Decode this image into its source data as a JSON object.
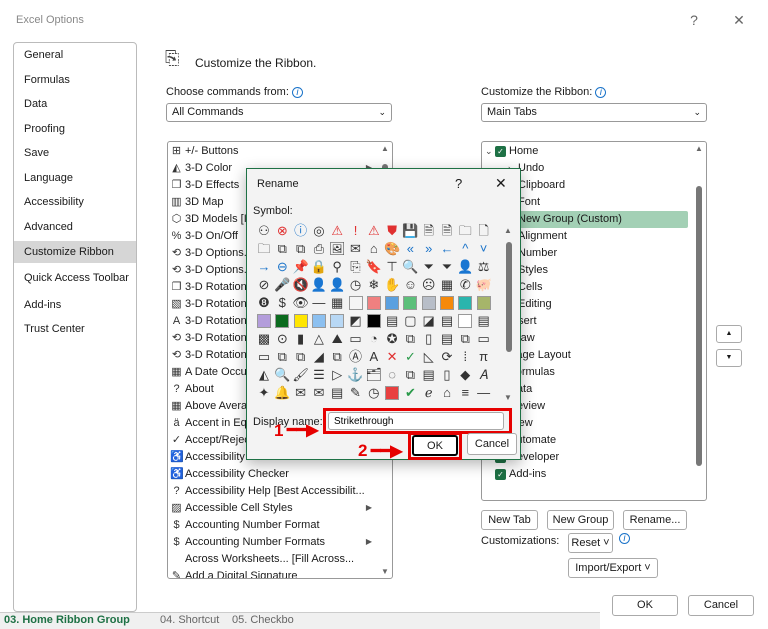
{
  "window": {
    "title": "Excel Options",
    "help": "?",
    "close": "✕"
  },
  "nav": [
    "General",
    "Formulas",
    "Data",
    "Proofing",
    "Save",
    "Language",
    "Accessibility",
    "Advanced",
    "Customize Ribbon",
    "Quick Access Toolbar",
    "Add-ins",
    "Trust Center"
  ],
  "nav_selected": 8,
  "header": {
    "title": "Customize the Ribbon."
  },
  "left": {
    "label": "Choose commands from:",
    "value": "All Commands",
    "items": [
      {
        "icon": "⊞",
        "label": "+/- Buttons"
      },
      {
        "icon": "◭",
        "label": "3-D Color",
        "sub": true
      },
      {
        "icon": "❐",
        "label": "3-D Effects"
      },
      {
        "icon": "▥",
        "label": "3D Map"
      },
      {
        "icon": "⬡",
        "label": "3D Models [Insert 3D Model]"
      },
      {
        "icon": "%",
        "label": "3-D On/Off"
      },
      {
        "icon": "⟲",
        "label": "3-D Options..."
      },
      {
        "icon": "⟲",
        "label": "3-D Options..."
      },
      {
        "icon": "❐",
        "label": "3-D Rotation"
      },
      {
        "icon": "▧",
        "label": "3-D Rotation"
      },
      {
        "icon": "A",
        "label": "3-D Rotation"
      },
      {
        "icon": "⟲",
        "label": "3-D Rotation"
      },
      {
        "icon": "⟲",
        "label": "3-D Rotation"
      },
      {
        "icon": "▦",
        "label": "A Date Occurring..."
      },
      {
        "icon": "?",
        "label": "About"
      },
      {
        "icon": "▦",
        "label": "Above Average..."
      },
      {
        "icon": "ä",
        "label": "Accent in Equation"
      },
      {
        "icon": "✓",
        "label": "Accept/Reject Changes"
      },
      {
        "icon": "♿",
        "label": "Accessibility"
      },
      {
        "icon": "♿",
        "label": "Accessibility Checker"
      },
      {
        "icon": "?",
        "label": "Accessibility Help [Best Accessibilit..."
      },
      {
        "icon": "▨",
        "label": "Accessible Cell Styles",
        "sub": true
      },
      {
        "icon": "$",
        "label": "Accounting Number Format"
      },
      {
        "icon": "$",
        "label": "Accounting Number Formats",
        "sub": true
      },
      {
        "icon": "",
        "label": "Across Worksheets... [Fill Across..."
      },
      {
        "icon": "✎",
        "label": "Add a Digital Signature"
      }
    ]
  },
  "right": {
    "label": "Customize the Ribbon:",
    "value": "Main Tabs",
    "items": [
      {
        "label": "Home",
        "level": 0,
        "check": true,
        "tw": "⌄"
      },
      {
        "label": "Undo",
        "level": 1,
        "tw": "›"
      },
      {
        "label": "Clipboard",
        "level": 1,
        "tw": "›"
      },
      {
        "label": "Font",
        "level": 1,
        "tw": "›"
      },
      {
        "label": "New Group (Custom)",
        "level": 1,
        "sel": true
      },
      {
        "label": "Alignment",
        "level": 1,
        "tw": "›"
      },
      {
        "label": "Number",
        "level": 1,
        "tw": "›"
      },
      {
        "label": "Styles",
        "level": 1,
        "tw": "›"
      },
      {
        "label": "Cells",
        "level": 1,
        "tw": "›"
      },
      {
        "label": "Editing",
        "level": 1,
        "tw": "›"
      },
      {
        "label": "Insert",
        "level": 0,
        "check": true,
        "tw": "›"
      },
      {
        "label": "Draw",
        "level": 0,
        "check": true,
        "tw": "›"
      },
      {
        "label": "Page Layout",
        "level": 0,
        "check": true,
        "tw": "›"
      },
      {
        "label": "Formulas",
        "level": 0,
        "check": true,
        "tw": "›"
      },
      {
        "label": "Data",
        "level": 0,
        "check": true,
        "tw": "›"
      },
      {
        "label": "Review",
        "level": 0,
        "check": true,
        "tw": "›"
      },
      {
        "label": "View",
        "level": 0,
        "check": true,
        "tw": "›"
      },
      {
        "label": "Automate",
        "level": 0,
        "check": true,
        "tw": "›"
      },
      {
        "label": "Developer",
        "level": 0,
        "check": true,
        "tw": "›"
      },
      {
        "label": "Add-ins",
        "level": 0,
        "check": true,
        "tw": ""
      }
    ],
    "new_tab": "New Tab",
    "new_group": "New Group",
    "rename": "Rename...",
    "customizations": "Customizations:",
    "reset": "Reset ˅",
    "import_export": "Import/Export ˅"
  },
  "footer": {
    "ok": "OK",
    "cancel": "Cancel"
  },
  "rename": {
    "title": "Rename",
    "help": "?",
    "close": "✕",
    "symbol_label": "Symbol:",
    "display_name_label": "Display name:",
    "display_name_value": "Strikethrough",
    "ok": "OK",
    "cancel": "Cancel",
    "symbols": [
      "⚇",
      "⊗",
      "ⓘ",
      "◎",
      "⚠",
      "!",
      "⚠",
      "⛊",
      "💾",
      "🗎",
      "🗎",
      "🗀",
      "🗋",
      "🗀",
      "⧉",
      "⧉",
      "⎙",
      "🖼",
      "✉",
      "⌂",
      "🎨",
      "«",
      "»",
      "←",
      "^",
      "˅",
      "→",
      "⊖",
      "📌",
      "🔒",
      "⚲",
      "⎘",
      "🔖",
      "⊤",
      "🔍",
      "⏷",
      "⏷",
      "👤",
      "⚖",
      "⊘",
      "🎤",
      "🔇",
      "👤",
      "👤",
      "◷",
      "❄",
      "✋",
      "☺",
      "☹",
      "▦",
      "✆",
      "🐖",
      "❽",
      "$",
      "👁",
      "—",
      "▦",
      "#f5f5f5",
      "#f08080",
      "#5aa0e0",
      "#5cbf7a",
      "#b8bec8",
      "#f5890a",
      "#2bb5ad",
      "#a6b56a",
      "#b39ddb",
      "#0b6b1e",
      "#ffe600",
      "#8cc0f0",
      "#b8d8f5",
      "◩",
      "#000000",
      "▤",
      "▢",
      "◪",
      "▤",
      "#ffffff",
      "▤",
      "▩",
      "⊙",
      "▮",
      "△",
      "⛰",
      "▭",
      "◔",
      "✪",
      "⧉",
      "▯",
      "▤",
      "⧉",
      "▭",
      "▭",
      "⧉",
      "⧉",
      "◢",
      "⧉",
      "Ⓐ",
      "A",
      "✕",
      "✓",
      "◺",
      "⟳",
      "⁞",
      "π",
      "◭",
      "🔍",
      "🖌",
      "☰",
      "▷",
      "⚓",
      "🗂",
      "◌",
      "⧉",
      "▤",
      "▯",
      "◆",
      "𝐴",
      "✦",
      "🔔",
      "✉",
      "✉",
      "▤",
      "✎",
      "◷",
      "#e84040",
      "✔",
      "ℯ",
      "⌂",
      "≡",
      "—"
    ],
    "annotation_1": "1",
    "annotation_2": "2"
  },
  "sheet_tabs": [
    "03. Home Ribbon Group",
    "04. Shortcut",
    "05. Checkbo"
  ]
}
